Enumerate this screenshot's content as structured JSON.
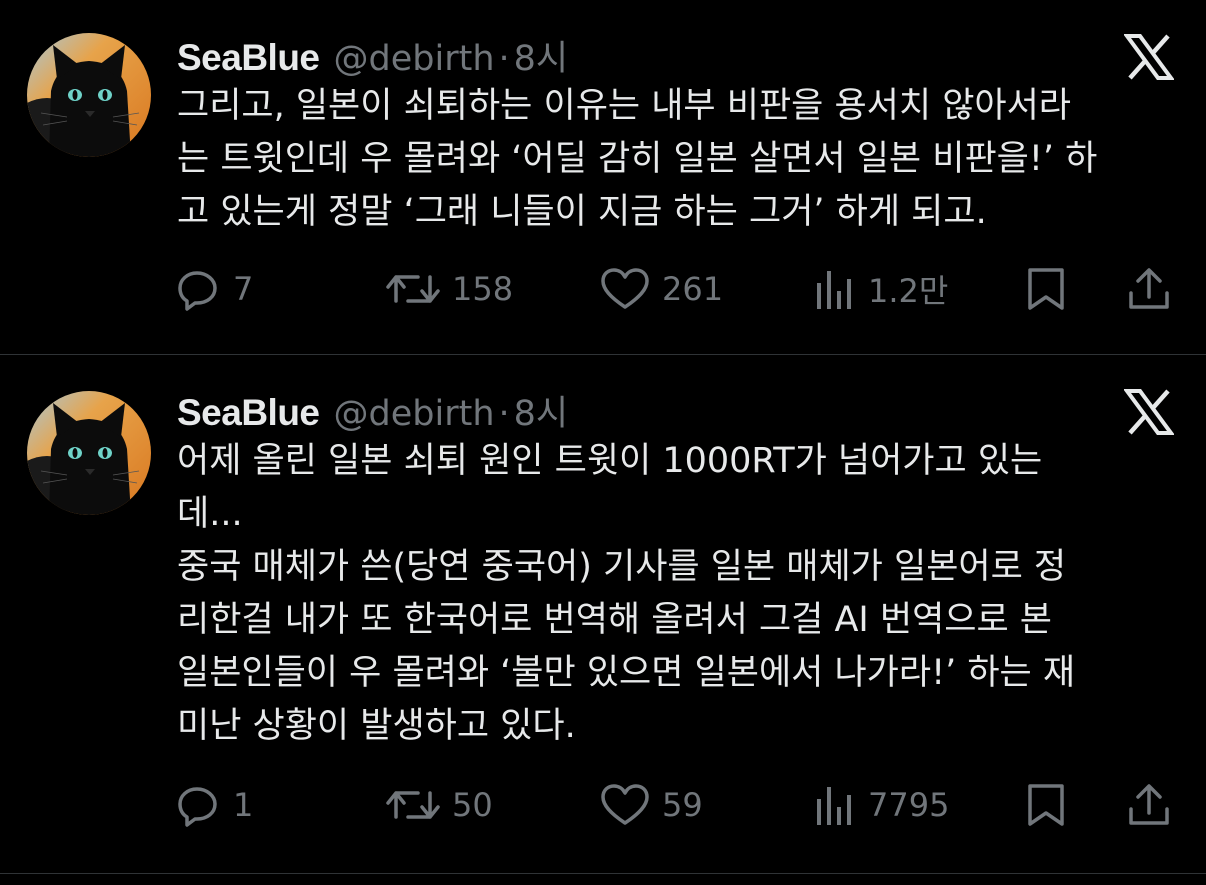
{
  "tweets": [
    {
      "author": {
        "name": "SeaBlue",
        "handle": "@debirth",
        "separator": "·",
        "time": "8시",
        "avatar_icon": "black-cat-avatar"
      },
      "text": "그리고, 일본이 쇠퇴하는 이유는 내부 비판을 용서치 않아서라\n는 트윗인데 우 몰려와 ‘어딜 감히 일본 살면서 일본 비판을!’ 하\n고 있는게 정말 ‘그래 니들이 지금 하는 그거’ 하게 되고.",
      "stats": {
        "replies": "7",
        "retweets": "158",
        "likes": "261",
        "views": "1.2만"
      }
    },
    {
      "author": {
        "name": "SeaBlue",
        "handle": "@debirth",
        "separator": "·",
        "time": "8시",
        "avatar_icon": "black-cat-avatar"
      },
      "text": "어제 올린 일본 쇠퇴 원인 트윗이 1000RT가 넘어가고 있는\n데...\n중국 매체가 쓴(당연 중국어) 기사를 일본 매체가 일본어로 정\n리한걸 내가 또 한국어로 번역해 올려서 그걸 AI 번역으로 본\n일본인들이 우 몰려와 ‘불만 있으면 일본에서 나가라!’ 하는 재\n미난 상황이 발생하고 있다.",
      "stats": {
        "replies": "1",
        "retweets": "50",
        "likes": "59",
        "views": "7795"
      }
    }
  ],
  "icons": {
    "brand": "x-logo-icon",
    "reply": "reply-icon",
    "retweet": "retweet-icon",
    "like": "heart-icon",
    "views": "views-chart-icon",
    "bookmark": "bookmark-icon",
    "share": "share-icon"
  },
  "colors": {
    "background": "#000000",
    "text": "#e7e9ea",
    "secondary": "#71767b",
    "divider": "#2f3336",
    "avatar_orange": "#e8902e",
    "cat_eyes": "#6fd3c9"
  }
}
